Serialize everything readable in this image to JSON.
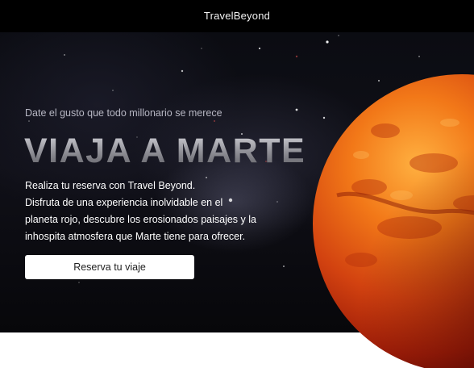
{
  "header": {
    "brand": "TravelBeyond"
  },
  "hero": {
    "tagline": "Date el gusto que todo millonario se merece",
    "headline": "VIAJA A MARTE",
    "description_lines": [
      "Realiza tu reserva con Travel Beyond.",
      "Disfruta de una experiencia inolvidable en el",
      "planeta rojo, descubre los erosionados paisajes y la",
      "inhospita atmosfera que Marte tiene para ofrecer."
    ],
    "cta_label": "Reserva tu viaje"
  },
  "colors": {
    "background_space": "#0b0c12",
    "text_primary": "#ffffff",
    "tagline": "#b7b7c3",
    "button_bg": "#ffffff",
    "mars_core": "#f57a1c",
    "mars_edge": "#8e1206"
  }
}
